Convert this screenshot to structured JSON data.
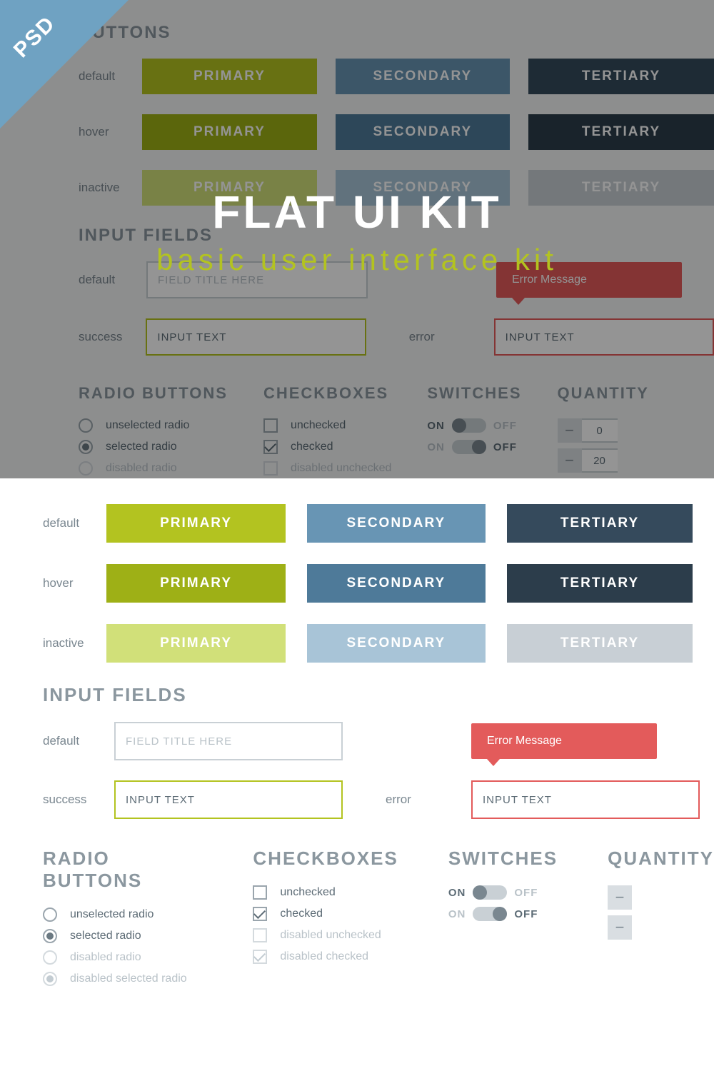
{
  "ribbon": "PSD",
  "overlay": {
    "title": "FLAT UI KIT",
    "subtitle": "basic user interface kit"
  },
  "sections": {
    "buttons": "BUTTONS",
    "inputs": "INPUT FIELDS",
    "radios": "RADIO BUTTONS",
    "checks": "CHECKBOXES",
    "switches": "SWITCHES",
    "quantity": "QUANTITY"
  },
  "states": {
    "default": "default",
    "hover": "hover",
    "inactive": "inactive",
    "success": "success",
    "error": "error"
  },
  "btn": {
    "primary": "PRIMARY",
    "secondary": "SECONDARY",
    "tertiary": "TERTIARY"
  },
  "input": {
    "placeholder": "FIELD TITLE HERE",
    "value": "INPUT TEXT",
    "errorMsg": "Error Message"
  },
  "radio": {
    "unselected": "unselected radio",
    "selected": "selected radio",
    "disabled": "disabled radio",
    "disabledSelected": "disabled selected radio"
  },
  "check": {
    "unchecked": "unchecked",
    "checked": "checked",
    "disabledUnchecked": "disabled unchecked",
    "disabledChecked": "disabled checked"
  },
  "switch": {
    "on": "ON",
    "off": "OFF"
  },
  "qty": {
    "zero": "0",
    "twenty": "20",
    "minus": "−",
    "plus": "+"
  }
}
